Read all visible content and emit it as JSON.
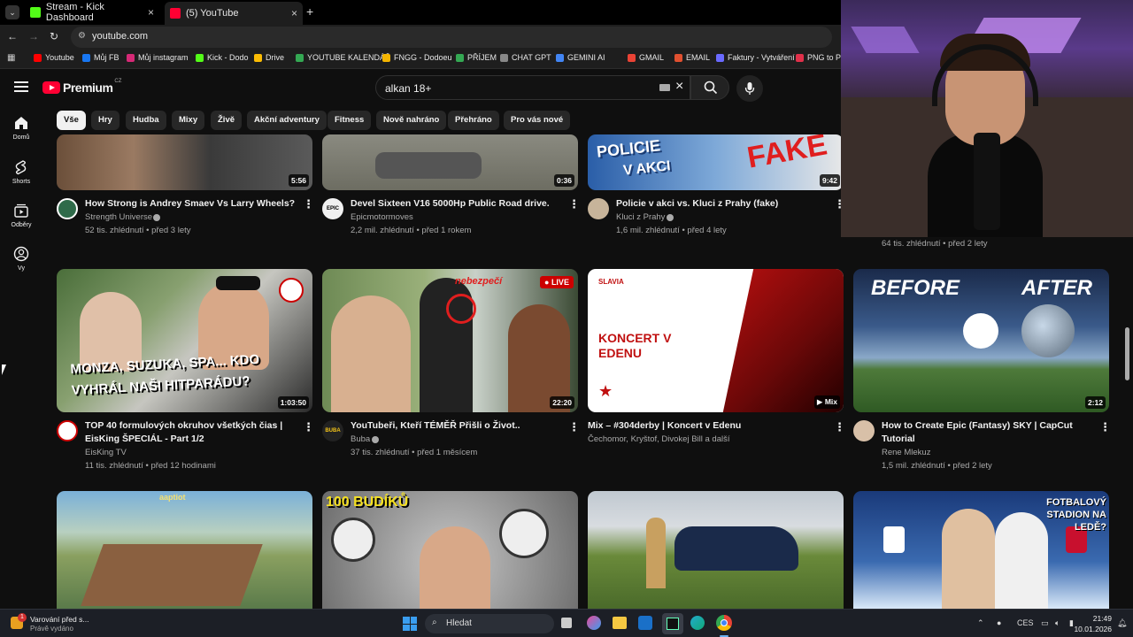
{
  "browser": {
    "tabs": [
      {
        "label": "Stream - Kick Dashboard",
        "favicon_color": "#53fc18"
      },
      {
        "label": "(5) YouTube",
        "favicon_color": "#ff0033"
      }
    ],
    "new_tab_symbol": "+",
    "close_symbol": "×",
    "url": "youtube.com",
    "bookmarks": [
      {
        "label": "Youtube",
        "color": "#ff0000"
      },
      {
        "label": "Můj FB",
        "color": "#1877f2"
      },
      {
        "label": "Můj instagram",
        "color": "#d62976"
      },
      {
        "label": "Kick - Dodo",
        "color": "#53fc18"
      },
      {
        "label": "Drive",
        "color": "#fbbc04"
      },
      {
        "label": "YOUTUBE KALENDÁŘ",
        "color": "#34a853"
      },
      {
        "label": "FNGG - Dodoeu",
        "color": "#f4b400"
      },
      {
        "label": "PŘÍJEM",
        "color": "#34a853"
      },
      {
        "label": "CHAT GPT",
        "color": "#888888"
      },
      {
        "label": "GEMINI AI",
        "color": "#4285f4"
      },
      {
        "label": "GMAIL",
        "color": "#ea4335"
      },
      {
        "label": "EMAIL",
        "color": "#e05030"
      },
      {
        "label": "Faktury - Vytváření",
        "color": "#6a6aff"
      },
      {
        "label": "PNG to PDF",
        "color": "#e0304a"
      }
    ]
  },
  "youtube": {
    "logo_text": "Premium",
    "region": "CZ",
    "search_value": "alkan 18+",
    "chips": [
      "Vše",
      "Hry",
      "Hudba",
      "Mixy",
      "Živě",
      "Akční adventury",
      "Fitness",
      "Nově nahráno",
      "Přehráno",
      "Pro vás nové"
    ],
    "sidebar": [
      {
        "label": "Domů",
        "icon": "home-icon"
      },
      {
        "label": "Shorts",
        "icon": "shorts-icon"
      },
      {
        "label": "Odběry",
        "icon": "subscriptions-icon"
      },
      {
        "label": "Vy",
        "icon": "user-icon"
      }
    ],
    "row1": [
      {
        "title": "How Strong is Andrey Smaev Vs Larry Wheels?",
        "channel": "Strength Universe",
        "meta": "52 tis. zhlédnutí • před 3 lety",
        "duration": "5:56"
      },
      {
        "title": "Devel Sixteen V16 5000Hp Public Road drive.",
        "channel": "Epicmotormoves",
        "meta": "2,2 mil. zhlédnutí • před 1 rokem",
        "duration": "0:36",
        "avatar_text": "EPIC"
      },
      {
        "title": "Policie v akci vs. Kluci z Prahy (fake)",
        "channel": "Kluci z Prahy",
        "meta": "1,6 mil. zhlédnutí • před 4 lety",
        "duration": "9:42",
        "thumb_text_1": "POLICIE",
        "thumb_text_2": "V AKCI",
        "thumb_text_3": "FAKE"
      }
    ],
    "row1_partial_meta": "64 tis. zhlédnutí • před 2 lety",
    "row2": [
      {
        "title": "TOP 40 formulových okruhov všetkých čias | EisKing ŠPECIÁL - Part 1/2",
        "channel": "EisKing TV",
        "meta": "11 tis. zhlédnutí • před 12 hodinami",
        "duration": "1:03:50",
        "thumb_text": "MONZA, SUZUKA, SPA... KDO VYHRÁL NAŠI HITPARÁDU?"
      },
      {
        "title": "YouTubeři, Kteří TÉMĚŘ Přišli o Život..",
        "channel": "Buba",
        "meta": "37 tis. zhlédnutí • před 1 měsícem",
        "duration": "22:20",
        "badge": "LIVE",
        "thumb_text": "nebezpečí",
        "avatar_text": "BUBA"
      },
      {
        "title": "Mix – #304derby | Koncert v Edenu",
        "channel": "Čechomor, Kryštof, Divokej Bill a další",
        "meta": "",
        "duration": "Mix",
        "thumb_text": "KONCERT V EDENU",
        "thumb_label": "SLAVIA"
      },
      {
        "title": "How to Create Epic (Fantasy) SKY | CapCut Tutorial",
        "channel": "Rene Mlekuz",
        "meta": "1,5 mil. zhlédnutí • před 2 lety",
        "duration": "2:12",
        "thumb_text_1": "BEFORE",
        "thumb_text_2": "AFTER"
      }
    ],
    "row3": [
      {
        "thumb_text": "aaptiot"
      },
      {
        "thumb_text": "100 BUDÍKŮ"
      },
      {
        "thumb_text": ""
      },
      {
        "thumb_text": "FOTBALOVÝ STADION NA LEDĚ?"
      }
    ]
  },
  "taskbar": {
    "notification_title": "Varování před s...",
    "notification_sub": "Právě vydáno",
    "notification_count": "1",
    "search_placeholder": "Hledat",
    "language": "CES",
    "time": "21:49",
    "date": "10.01.2026"
  }
}
